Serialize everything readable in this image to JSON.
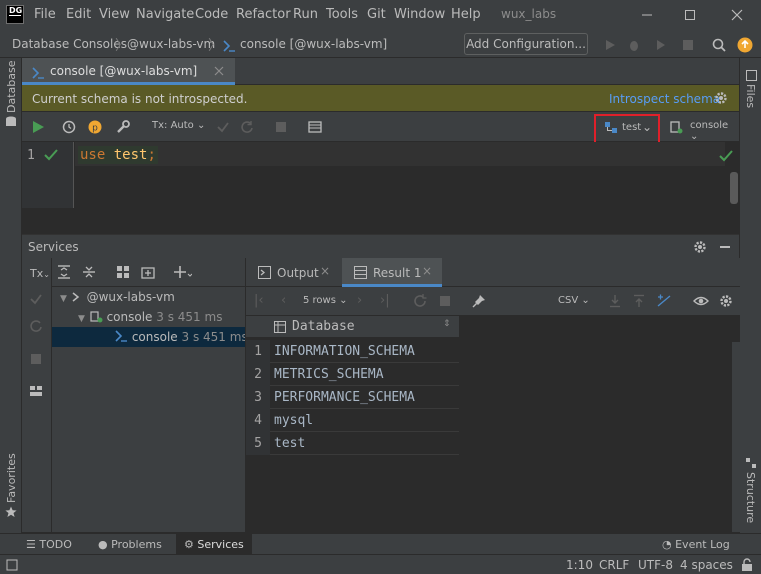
{
  "app": {
    "logo_text": "DG",
    "menu": [
      "File",
      "Edit",
      "View",
      "Navigate",
      "Code",
      "Refactor",
      "Run",
      "Tools",
      "Git",
      "Window",
      "Help"
    ],
    "window_title": "wux_labs"
  },
  "breadcrumb": {
    "items": [
      "Database Consoles",
      "@wux-labs-vm",
      "console [@wux-labs-vm]"
    ],
    "add_config_label": "Add Configuration..."
  },
  "left_stripe": {
    "top_label": "Database",
    "bottom_label": "Favorites"
  },
  "right_stripe": {
    "top_label": "Files",
    "bottom_label": "Structure"
  },
  "editor_tab": {
    "label": "console [@wux-labs-vm]"
  },
  "notification": {
    "message": "Current schema is not introspected.",
    "link": "Introspect schema"
  },
  "editor_toolbar": {
    "tx_mode": "Tx: Auto",
    "schema": "test",
    "session": "console"
  },
  "editor": {
    "line_number": "1",
    "keyword": "use",
    "identifier": "test",
    "terminator": ";"
  },
  "services": {
    "title": "Services",
    "toolbar_tx": "Tx",
    "tree": [
      {
        "label": "@wux-labs-vm",
        "meta": ""
      },
      {
        "label": "console",
        "meta": "3 s 451 ms"
      },
      {
        "label": "console",
        "meta": "3 s 451 ms"
      }
    ]
  },
  "results": {
    "tabs": [
      "Output",
      "Result 1"
    ],
    "rows_label": "5 rows",
    "export_format": "CSV",
    "column": "Database",
    "rows": [
      {
        "n": "1",
        "value": "INFORMATION_SCHEMA"
      },
      {
        "n": "2",
        "value": "METRICS_SCHEMA"
      },
      {
        "n": "3",
        "value": "PERFORMANCE_SCHEMA"
      },
      {
        "n": "4",
        "value": "mysql"
      },
      {
        "n": "5",
        "value": "test"
      }
    ]
  },
  "bottom_tabs": [
    "TODO",
    "Problems",
    "Services"
  ],
  "event_log": "Event Log",
  "status": {
    "position": "1:10",
    "line_sep": "CRLF",
    "encoding": "UTF-8",
    "indent": "4 spaces"
  },
  "colors": {
    "accent": "#4a88c7",
    "highlight_box": "#e0202a",
    "run_green": "#499c54",
    "notice_bg": "#5a5a26"
  }
}
